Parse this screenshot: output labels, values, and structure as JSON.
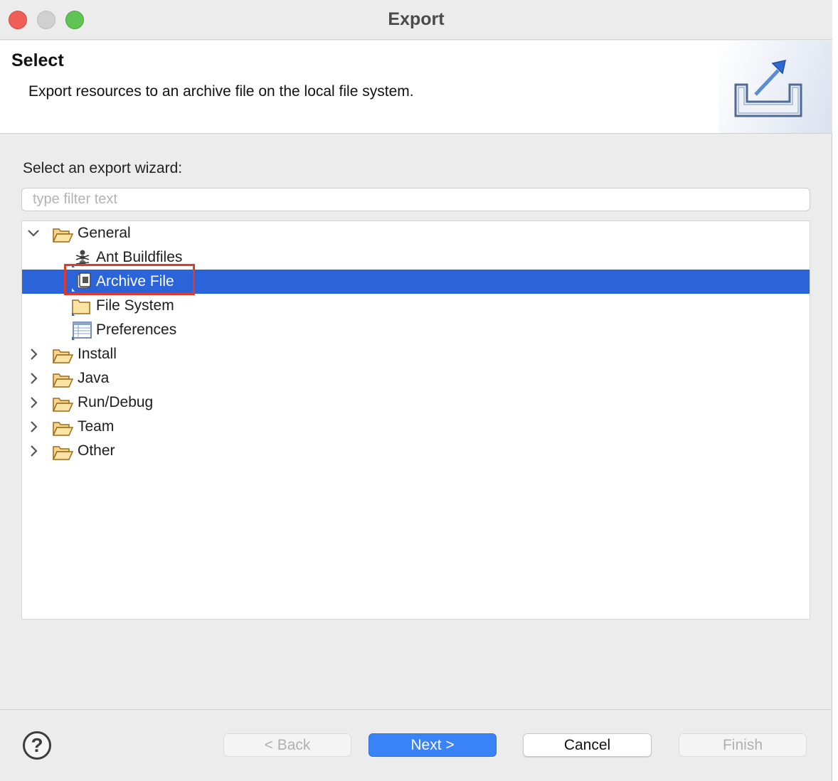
{
  "window": {
    "title": "Export"
  },
  "header": {
    "title": "Select",
    "description": "Export resources to an archive file on the local file system.",
    "icon": "export-wizard-icon"
  },
  "body": {
    "prompt": "Select an export wizard:",
    "filter_placeholder": "type filter text",
    "filter_value": ""
  },
  "tree": {
    "items": [
      {
        "label": "General",
        "icon": "folder-open-icon",
        "expanded": true
      },
      {
        "label": "Ant Buildfiles",
        "icon": "ant-icon"
      },
      {
        "label": "Archive File",
        "icon": "archive-file-icon",
        "selected": true
      },
      {
        "label": "File System",
        "icon": "folder-icon"
      },
      {
        "label": "Preferences",
        "icon": "preferences-icon"
      },
      {
        "label": "Install",
        "icon": "folder-open-icon",
        "expanded": false
      },
      {
        "label": "Java",
        "icon": "folder-open-icon",
        "expanded": false
      },
      {
        "label": "Run/Debug",
        "icon": "folder-open-icon",
        "expanded": false
      },
      {
        "label": "Team",
        "icon": "folder-open-icon",
        "expanded": false
      },
      {
        "label": "Other",
        "icon": "folder-open-icon",
        "expanded": false
      }
    ]
  },
  "footer": {
    "help_label": "?",
    "back_label": "< Back",
    "next_label": "Next >",
    "cancel_label": "Cancel",
    "finish_label": "Finish"
  },
  "colors": {
    "selection": "#2b63d9",
    "primary_button": "#3a82f7",
    "highlight_outline": "#e03a2c"
  }
}
